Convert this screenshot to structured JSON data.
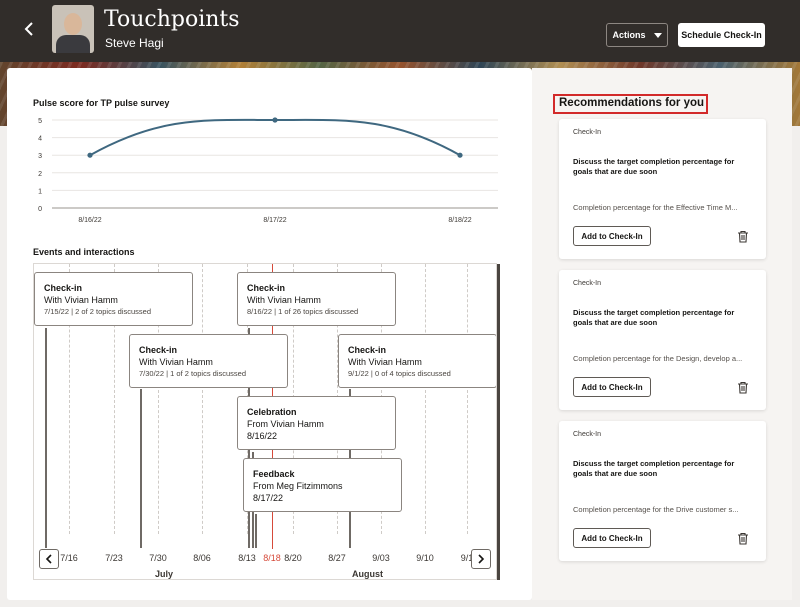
{
  "header": {
    "back_icon": "chevron-left-icon",
    "title": "Touchpoints",
    "subtitle": "Steve Hagi",
    "actions_label": "Actions",
    "schedule_label": "Schedule Check-In"
  },
  "pulse": {
    "title": "Pulse score for TP pulse survey",
    "chart_data": {
      "type": "line",
      "x": [
        "8/16/22",
        "8/17/22",
        "8/18/22"
      ],
      "series": [
        {
          "values": [
            3,
            5,
            3
          ]
        }
      ],
      "y_ticks": [
        "0",
        "1",
        "2",
        "3",
        "4",
        "5"
      ],
      "ylim": [
        0,
        5
      ],
      "line_color": "#3f6880"
    }
  },
  "events": {
    "title": "Events and interactions",
    "cards": [
      {
        "title": "Check-in",
        "sub": "With Vivian Hamm",
        "meta": "7/15/22 | 2 of 2 topics discussed"
      },
      {
        "title": "Check-in",
        "sub": "With Vivian Hamm",
        "meta": "8/16/22 | 1 of 26 topics discussed"
      },
      {
        "title": "Check-in",
        "sub": "With  Vivian Hamm",
        "meta": "7/30/22 | 1 of 2 topics discussed"
      },
      {
        "title": "Check-in",
        "sub": "With Vivian Hamm",
        "meta": "9/1/22 | 0 of 4 topics discussed"
      },
      {
        "title": "Celebration",
        "sub": "From Vivian Hamm",
        "meta": "8/16/22"
      },
      {
        "title": "Feedback",
        "sub": "From Meg Fitzimmons",
        "meta": "8/17/22"
      }
    ],
    "axis_dates": [
      "7/16",
      "7/23",
      "7/30",
      "8/06",
      "8/13",
      "8/18",
      "8/20",
      "8/27",
      "9/03",
      "9/10",
      "9/1"
    ],
    "months": [
      "July",
      "August"
    ],
    "prev_icon": "chevron-left-icon",
    "next_icon": "chevron-right-icon"
  },
  "recommendations": {
    "title": "Recommendations for you",
    "items": [
      {
        "tag": "Check-In",
        "title": "Discuss the target completion percentage for goals that are due soon",
        "desc": "Completion percentage for the Effective Time M...",
        "button": "Add to Check-In"
      },
      {
        "tag": "Check-In",
        "title": "Discuss the target completion percentage for goals that are due soon",
        "desc": "Completion percentage for the Design, develop a...",
        "button": "Add to Check-In"
      },
      {
        "tag": "Check-In",
        "title": "Discuss the target completion percentage for goals that are due soon",
        "desc": "Completion percentage for the Drive customer s...",
        "button": "Add to Check-In"
      }
    ]
  },
  "colors": {
    "header_bg": "#312d2a",
    "highlight": "#d22a2a",
    "today_line": "#d64a3a"
  }
}
